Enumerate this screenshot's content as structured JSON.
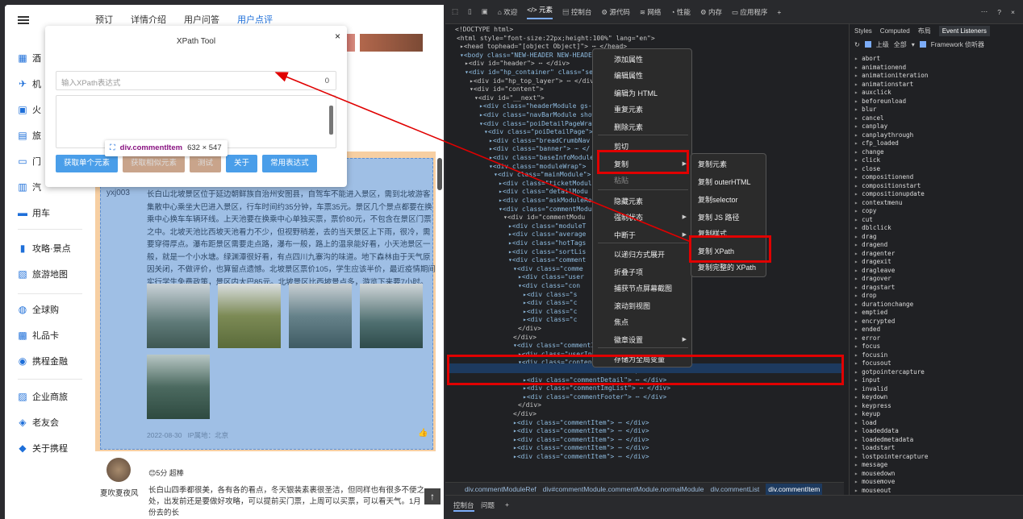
{
  "web": {
    "tabs": [
      "预订",
      "详情介绍",
      "用户问答",
      "用户点评"
    ],
    "nav": [
      {
        "label": "酒",
        "icon": "building-icon"
      },
      {
        "label": "机",
        "icon": "plane-icon"
      },
      {
        "label": "火",
        "icon": "train-icon"
      },
      {
        "label": "旅",
        "icon": "suitcase-icon"
      },
      {
        "label": "门",
        "icon": "ticket-icon"
      },
      {
        "label": "汽",
        "icon": "bus-icon"
      },
      {
        "label": "用车",
        "icon": "car-icon"
      },
      {
        "label": "攻略·景点",
        "icon": "guide-icon"
      },
      {
        "label": "旅游地图",
        "icon": "map-icon"
      },
      {
        "label": "全球购",
        "icon": "globe-icon"
      },
      {
        "label": "礼品卡",
        "icon": "gift-card-icon"
      },
      {
        "label": "携程金融",
        "icon": "finance-icon"
      },
      {
        "label": "企业商旅",
        "icon": "business-icon"
      },
      {
        "label": "老友会",
        "icon": "friends-icon"
      },
      {
        "label": "关于携程",
        "icon": "about-icon"
      }
    ],
    "review1": {
      "user": "yxj003",
      "text": "长白山北坡景区位于延边朝鲜族自治州安图县，自驾车不能进入景区，需到北坡游客集散中心乘坐大巴进入景区，行车时间约35分钟，车票35元。景区几个景点都要在换乘中心换车车辆环线。上天池要在换乘中心单独买票，票价80元，不包含在景区门票之中。北坡天池比西坡天池看力不少，但视野稍差，去的当天景区上下雨，很冷，需要穿得厚点。瀑布距景区需要走点路，瀑布一般，路上的温泉能好看，小天池景区一般，就是一个小水塘。绿渊潭很好看，有点四川九寨沟的味道。地下森林由于天气原因关闭，不做评价，也算留点遗憾。北坡景区票价105，学生应该半价，最近疫情期间实行学生免费政策，景区内大巴85元。北坡景区比西坡景点多，游览下来要7小时。",
      "date": "2022-08-30",
      "ip": "IP属地：北京"
    },
    "review2": {
      "user": "夏吹夏夜风",
      "rating": "5分 超棒",
      "text": "长白山四季都很美，各有各的看点，冬天银装素裹很圣洁，但同样也有很多不便之处，出发前还是要做好攻略，可以提前买门票，上周可以买票，可以看天气。1月份去的长"
    },
    "up_button": "↑"
  },
  "xpath_tool": {
    "title": "XPath Tool",
    "close": "×",
    "placeholder": "输入XPath表达式",
    "count": "0",
    "buttons": [
      "获取单个元素",
      "获取相似元素",
      "测试",
      "关于",
      "常用表达式"
    ]
  },
  "tooltip": {
    "tag": "div.commentItem",
    "size": "632 × 547"
  },
  "devtools": {
    "tabs": [
      "欢迎",
      "元素",
      "控制台",
      "源代码",
      "网络",
      "性能",
      "内存",
      "应用程序"
    ],
    "panel_tabs": [
      "Styles",
      "Computed",
      "布局",
      "Event Listeners"
    ],
    "filter": {
      "ancestors": "上级",
      "all": "全部",
      "framework": "Framework 侦听器"
    },
    "events": [
      "abort",
      "animationend",
      "animationiteration",
      "animationstart",
      "auxclick",
      "beforeunload",
      "blur",
      "cancel",
      "canplay",
      "canplaythrough",
      "cfp_loaded",
      "change",
      "click",
      "close",
      "compositionend",
      "compositionstart",
      "compositionupdate",
      "contextmenu",
      "copy",
      "cut",
      "dblclick",
      "drag",
      "dragend",
      "dragenter",
      "dragexit",
      "dragleave",
      "dragover",
      "dragstart",
      "drop",
      "durationchange",
      "emptied",
      "encrypted",
      "ended",
      "error",
      "focus",
      "focusin",
      "focusout",
      "gotpointercapture",
      "input",
      "invalid",
      "keydown",
      "keypress",
      "keyup",
      "load",
      "loadeddata",
      "loadedmetadata",
      "loadstart",
      "lostpointercapture",
      "message",
      "mousedown",
      "mousemove",
      "mouseout"
    ],
    "crumbs": [
      "div.commentModuleRef",
      "div#commentModule.commentModule.normalModule",
      "div.commentList",
      "div.commentItem"
    ],
    "drawer_tabs": [
      "控制台",
      "问题"
    ]
  },
  "context_menu": {
    "items": [
      "添加属性",
      "编辑属性",
      "编辑为 HTML",
      "重复元素",
      "删除元素",
      "剪切",
      "复制",
      "粘贴",
      "隐藏元素",
      "强制状态",
      "中断于",
      "以递归方式展开",
      "折叠子项",
      "捕获节点屏幕截图",
      "滚动到视图",
      "焦点",
      "徽章设置",
      "存储为全局变量"
    ],
    "submenu": [
      "复制元素",
      "复制 outerHTML",
      "复制selector",
      "复制 JS 路径",
      "复制样式",
      "复制 XPath",
      "复制完整的 XPath"
    ]
  },
  "colors": {
    "highlight": "#9fbfe5",
    "accent": "#1e6fd9",
    "red": "#e00000"
  }
}
